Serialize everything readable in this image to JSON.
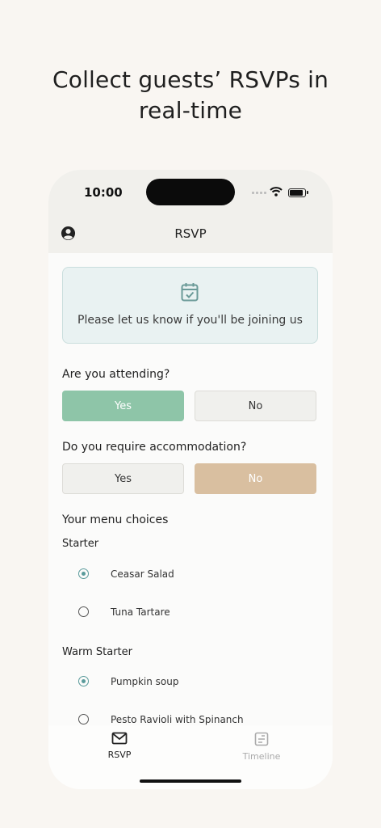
{
  "headline": {
    "line1": "Collect guests’ RSVPs in",
    "line2": "real-time"
  },
  "status": {
    "time": "10:00"
  },
  "nav": {
    "title": "RSVP"
  },
  "banner": {
    "text": "Please let us know if you'll be joining us",
    "icon": "calendar-check-icon"
  },
  "attending": {
    "label": "Are you attending?",
    "yes": "Yes",
    "no": "No",
    "selected": "Yes"
  },
  "accommodation": {
    "label": "Do you require accommodation?",
    "yes": "Yes",
    "no": "No",
    "selected": "No"
  },
  "menu": {
    "title": "Your menu choices",
    "groups": [
      {
        "name": "Starter",
        "options": [
          "Ceasar Salad",
          "Tuna Tartare"
        ],
        "selected": "Ceasar Salad"
      },
      {
        "name": "Warm Starter",
        "options": [
          "Pumpkin soup",
          "Pesto Ravioli with Spinanch"
        ],
        "selected": "Pumpkin soup"
      }
    ]
  },
  "tabs": [
    {
      "label": "RSVP",
      "icon": "mail-icon",
      "active": true
    },
    {
      "label": "Timeline",
      "icon": "timeline-icon",
      "active": false
    }
  ],
  "colors": {
    "accent_green": "#8ec5a8",
    "accent_tan": "#d9bfa0",
    "teal": "#5a9b9b"
  }
}
